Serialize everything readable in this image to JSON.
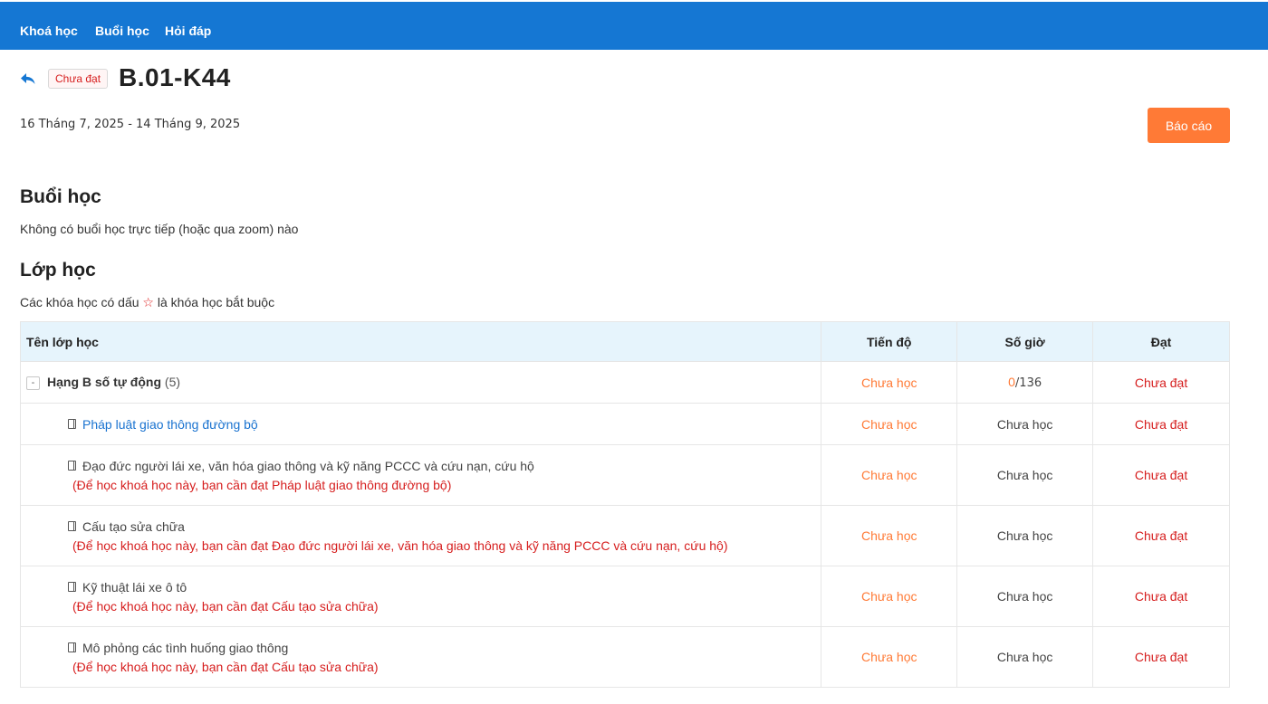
{
  "nav": {
    "items": [
      "Khoá học",
      "Buổi học",
      "Hỏi đáp"
    ]
  },
  "header": {
    "status_badge": "Chưa đạt",
    "title": "B.01-K44",
    "date_range": "16 Tháng 7, 2025 - 14 Tháng 9, 2025",
    "report_button": "Báo cáo",
    "back_icon": "back-arrow-icon"
  },
  "sessions": {
    "heading": "Buổi học",
    "text": "Không có buổi học trực tiếp (hoặc qua zoom) nào"
  },
  "classes": {
    "heading": "Lớp học",
    "note_before": "Các khóa học có dấu",
    "note_star": "☆",
    "note_after": "là khóa học bắt buộc",
    "columns": {
      "name": "Tên lớp học",
      "progress": "Tiến độ",
      "hours": "Số giờ",
      "pass": "Đạt"
    },
    "group": {
      "toggle": "-",
      "name": "Hạng B số tự động",
      "count": "(5)",
      "progress": "Chưa học",
      "hours_done": "0",
      "hours_total": "/136",
      "pass": "Chưa đạt"
    },
    "courses": [
      {
        "name": "Pháp luật giao thông đường bộ",
        "prereq": "",
        "progress": "Chưa học",
        "hours": "Chưa học",
        "pass": "Chưa đạt"
      },
      {
        "name": "Đạo đức người lái xe, văn hóa giao thông và kỹ năng PCCC và cứu nạn, cứu hộ",
        "prereq": "(Để học khoá học này, bạn cần đạt Pháp luật giao thông đường bộ)",
        "progress": "Chưa học",
        "hours": "Chưa học",
        "pass": "Chưa đạt"
      },
      {
        "name": "Cấu tạo sửa chữa",
        "prereq": "(Để học khoá học này, bạn cần đạt Đạo đức người lái xe, văn hóa giao thông và kỹ năng PCCC và cứu nạn, cứu hộ)",
        "progress": "Chưa học",
        "hours": "Chưa học",
        "pass": "Chưa đạt"
      },
      {
        "name": "Kỹ thuật lái xe ô tô",
        "prereq": "(Để học khoá học này, bạn cần đạt Cấu tạo sửa chữa)",
        "progress": "Chưa học",
        "hours": "Chưa học",
        "pass": "Chưa đạt"
      },
      {
        "name": "Mô phỏng các tình huống giao thông",
        "prereq": "(Để học khoá học này, bạn cần đạt Cấu tạo sửa chữa)",
        "progress": "Chưa học",
        "hours": "Chưa học",
        "pass": "Chưa đạt"
      }
    ]
  },
  "colors": {
    "nav_bg": "#1577d3",
    "accent_orange": "#ff7a36",
    "error_red": "#d61e1e",
    "link_blue": "#1a73d0",
    "table_header_bg": "#e6f4fc"
  }
}
